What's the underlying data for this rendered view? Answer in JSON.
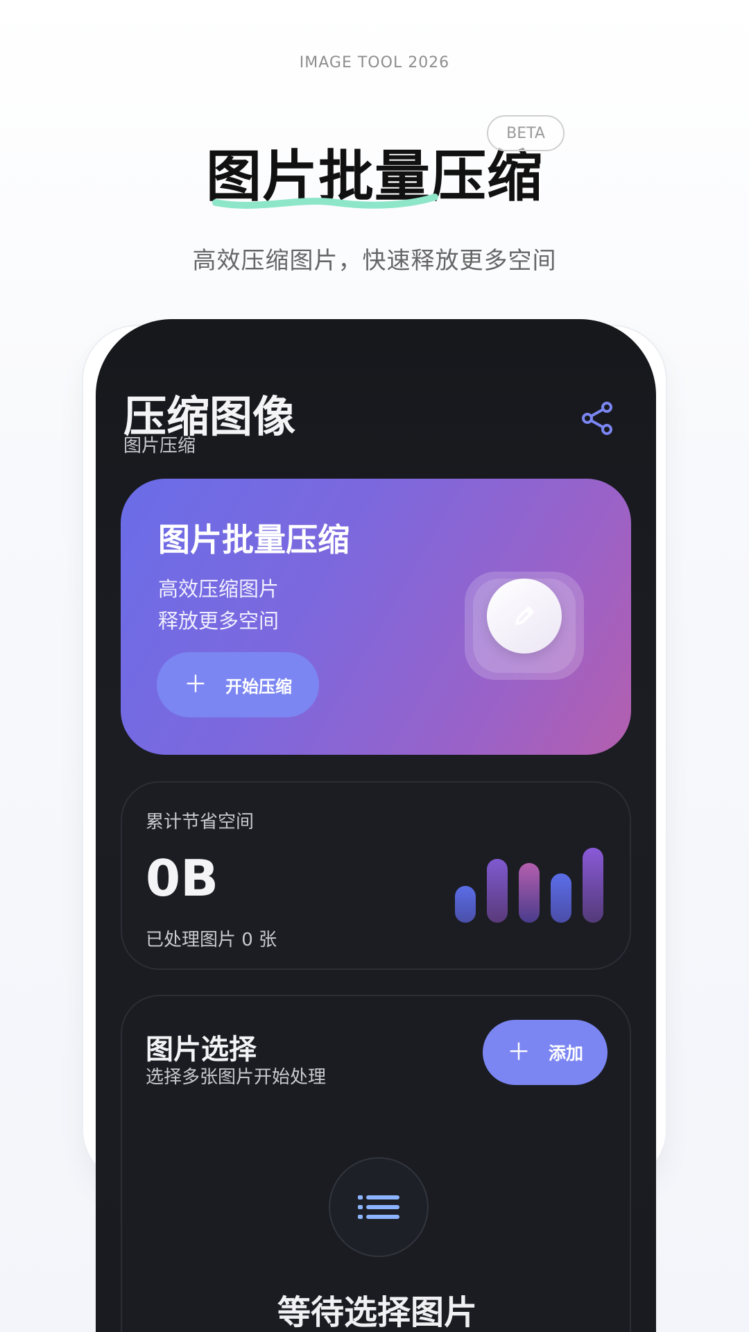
{
  "header": {
    "kicker": "IMAGE TOOL 2026",
    "title": "图片批量压缩",
    "badge": "BETA",
    "subtitle": "高效压缩图片，快速释放更多空间"
  },
  "app": {
    "title": "压缩图像",
    "subtitle": "图片压缩",
    "share_icon": "share-icon",
    "hero_card": {
      "title": "图片批量压缩",
      "line1": "高效压缩图片",
      "line2": "释放更多空间",
      "button_label": "开始压缩",
      "button_icon": "plus-icon",
      "decoration_icon": "pencil-icon"
    },
    "stats": {
      "label": "累计节省空间",
      "value": "0B",
      "count_text": "已处理图片 0 张",
      "bar_levels": [
        0.49,
        0.85,
        0.8,
        0.66,
        1.0
      ]
    },
    "selection": {
      "title": "图片选择",
      "subtitle": "选择多张图片开始处理",
      "add_label": "添加",
      "empty_icon": "list-icon",
      "empty_title": "等待选择图片"
    },
    "colors": {
      "accent": "#7b86f2",
      "card_gradient_start": "#6a6de8",
      "card_gradient_end": "#b45fae",
      "underline": "#8ee6c9"
    }
  }
}
